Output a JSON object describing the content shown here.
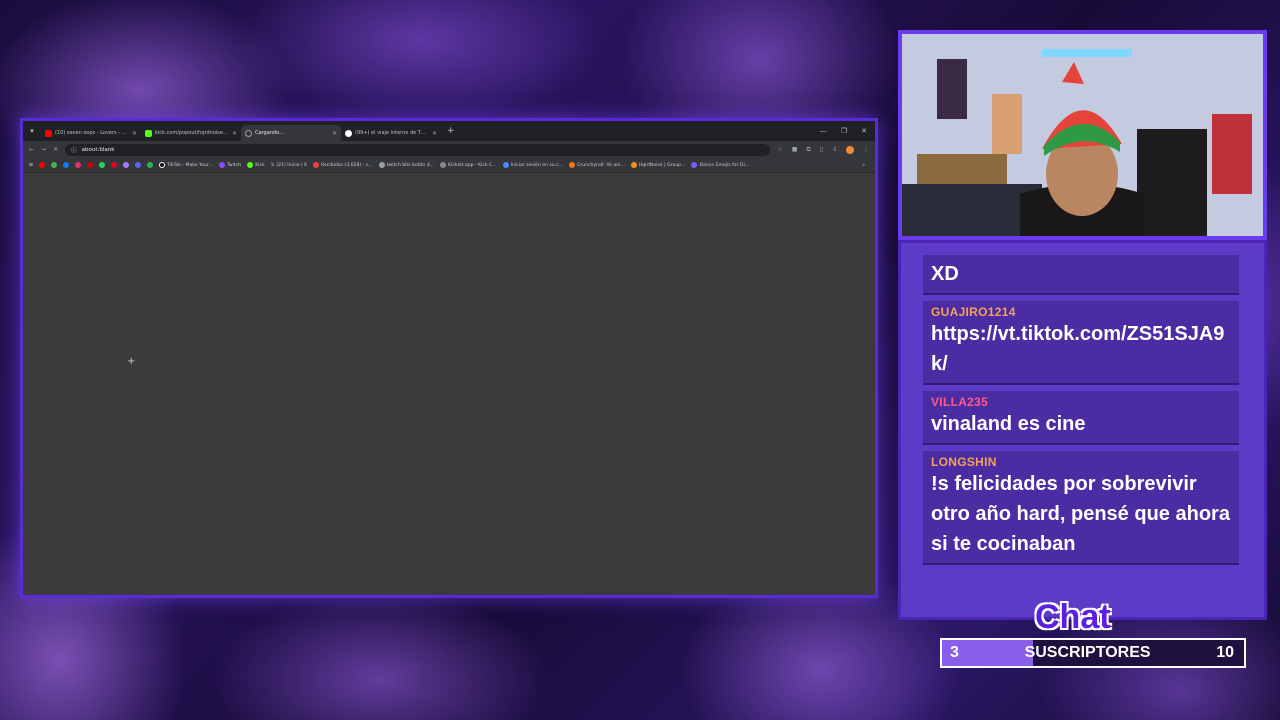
{
  "browser": {
    "tabs": [
      {
        "title": "(10) seven oops - Lovers - YouTube",
        "color": "#ff0000"
      },
      {
        "title": "kick.com/popout/hqrdnoise/chat",
        "color": "#53fc18"
      },
      {
        "title": "Cargando...",
        "color": "#9aa0a6"
      },
      {
        "title": "(99+) el viaje interno de Thorfinn",
        "color": "#ffffff"
      }
    ],
    "address": "about:blank",
    "bookmarks": [
      "TikTok - Make Your...",
      "Twitch",
      "Kick",
      "(21) Inicio / X",
      "Recibidos (3,628) - c...",
      "twitch bits botón d...",
      "Kicklet.app - Kick C...",
      "Iniciar sesión en su c...",
      "Crunchyroll: Ve ani...",
      "HqrdNoise | Group...",
      "Dance Emojis for Di..."
    ]
  },
  "chat": {
    "messages": [
      {
        "user": "",
        "text": "XD",
        "color": "#f4a259"
      },
      {
        "user": "GUAJIRO1214",
        "text": "https://vt.tiktok.com/ZS51SJA9k/",
        "color": "#f4a259"
      },
      {
        "user": "VILLA235",
        "text": "vinaland es cine",
        "color": "#ff5a8c"
      },
      {
        "user": "LONGSHIN",
        "text": "!s felicidades por sobrevivir otro año hard, pensé que ahora si te cocinaban",
        "color": "#f4a259"
      }
    ],
    "label": "Chat"
  },
  "subs": {
    "current": "3",
    "label": "SUSCRIPTORES",
    "goal": "10",
    "progress": 0.3
  }
}
